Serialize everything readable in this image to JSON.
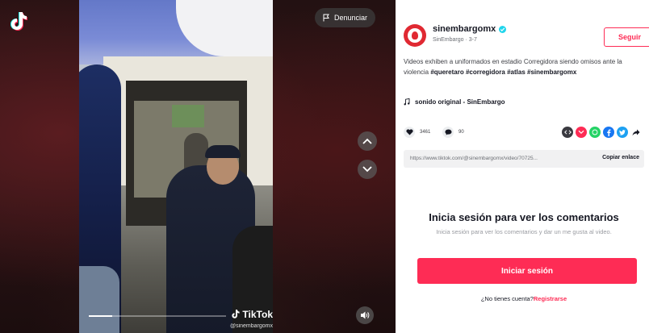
{
  "player": {
    "report_label": "Denunciar",
    "watermark_brand": "TikTok",
    "watermark_user": "@sinembargomx",
    "progress": 0.17
  },
  "author": {
    "username": "sinembargomx",
    "display_name": "SinEmbargo",
    "date": "3-7",
    "separator": "·",
    "follow_label": "Seguir"
  },
  "post": {
    "caption_text": "Videos exhiben a uniformados en estadio Corregidora siendo omisos ante la violencia ",
    "hashtags": [
      "#queretaro",
      "#corregidora",
      "#atlas",
      "#sinembargomx"
    ],
    "sound": "sonido original - SinEmbargo"
  },
  "stats": {
    "likes": "3461",
    "comments": "90"
  },
  "share": {
    "link": "https://www.tiktok.com/@sinembargomx/video/70725...",
    "copy_label": "Copiar enlace"
  },
  "comments_login": {
    "title": "Inicia sesión para ver los comentarios",
    "subtitle": "Inicia sesión para ver los comentarios y dar un me gusta al video.",
    "login_label": "Iniciar sesión",
    "no_account_text": "¿No tienes cuenta?",
    "signup_label": "Registrarse"
  },
  "colors": {
    "accent": "#fe2c55",
    "avatar": "#e02932",
    "verified": "#20d5ec"
  },
  "icons": [
    "tiktok-logo-icon",
    "flag-icon",
    "chevron-up-icon",
    "chevron-down-icon",
    "volume-icon",
    "verified-icon",
    "music-note-icon",
    "heart-icon",
    "comment-icon",
    "embed-icon",
    "pocket-icon",
    "whatsapp-icon",
    "facebook-icon",
    "twitter-icon",
    "share-arrow-icon"
  ]
}
